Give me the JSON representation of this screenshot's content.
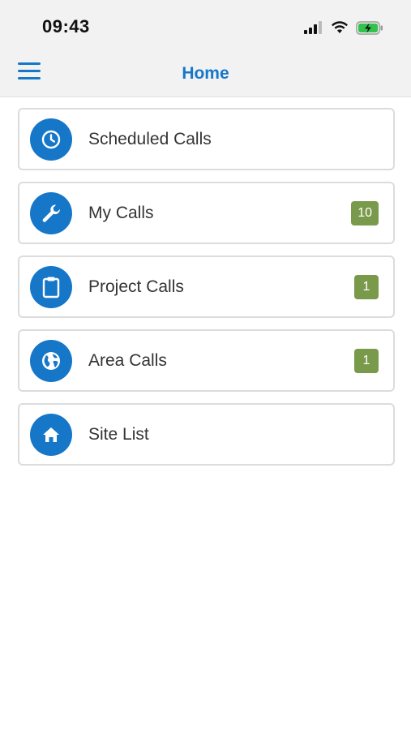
{
  "status_bar": {
    "time": "09:43",
    "icons": [
      "signal-icon",
      "wifi-icon",
      "battery-charging-icon"
    ]
  },
  "header": {
    "title": "Home",
    "menu_icon": "hamburger-menu-icon"
  },
  "colors": {
    "accent": "#1677c9",
    "badge": "#7a9a4b",
    "header_bg": "#f2f2f2",
    "card_border": "#dcdcdc"
  },
  "menu_items": [
    {
      "label": "Scheduled Calls",
      "icon": "clock-icon",
      "badge": ""
    },
    {
      "label": "My Calls",
      "icon": "wrench-icon",
      "badge": "10"
    },
    {
      "label": "Project Calls",
      "icon": "clipboard-icon",
      "badge": "1"
    },
    {
      "label": "Area Calls",
      "icon": "globe-icon",
      "badge": "1"
    },
    {
      "label": "Site List",
      "icon": "home-icon",
      "badge": ""
    }
  ]
}
